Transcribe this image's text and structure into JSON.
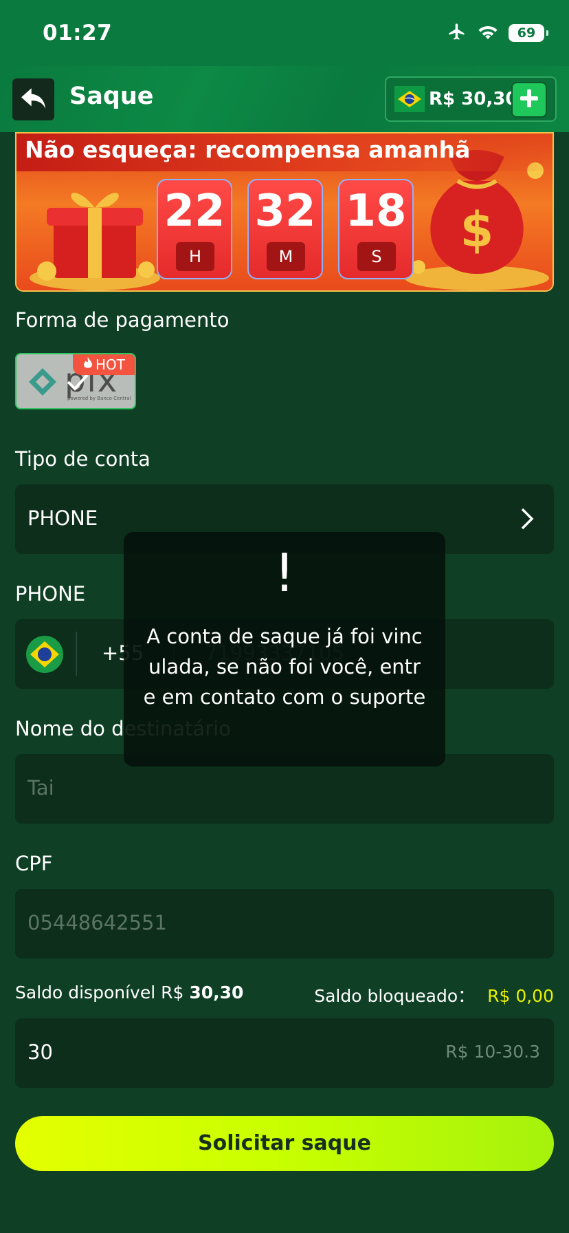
{
  "status_bar": {
    "time": "01:27",
    "battery": "69"
  },
  "header": {
    "title": "Saque",
    "balance": "R$ 30,30"
  },
  "banner": {
    "title": "Não esqueça: recompensa amanhã",
    "hours": "22",
    "hours_unit": "H",
    "minutes": "32",
    "minutes_unit": "M",
    "seconds": "18",
    "seconds_unit": "S"
  },
  "payment": {
    "label": "Forma de pagamento",
    "method": "pix",
    "method_sub": "powered by Banco Central",
    "badge": "HOT"
  },
  "account_type": {
    "label": "Tipo de conta",
    "value": "PHONE"
  },
  "phone": {
    "label": "PHONE",
    "country_code": "+55",
    "number": "71993337105"
  },
  "recipient": {
    "label": "Nome do destinatário",
    "value": "Tai"
  },
  "cpf": {
    "label": "CPF",
    "value": "05448642551"
  },
  "balances": {
    "available_label": "Saldo disponível R$",
    "available_value": "30,30",
    "blocked_label": "Saldo bloqueado：",
    "blocked_value": "R$ 0,00"
  },
  "amount": {
    "value": "30",
    "hint": "R$ 10-30.3"
  },
  "submit_label": "Solicitar saque",
  "toast": {
    "icon": "!",
    "message": "A conta de saque já foi vinculada, se não foi você, entre em contato com o suporte"
  },
  "colors": {
    "accent_green": "#0a7a3e",
    "button_yellow": "#e4ff00",
    "blocked_yellow": "#e8f000"
  }
}
